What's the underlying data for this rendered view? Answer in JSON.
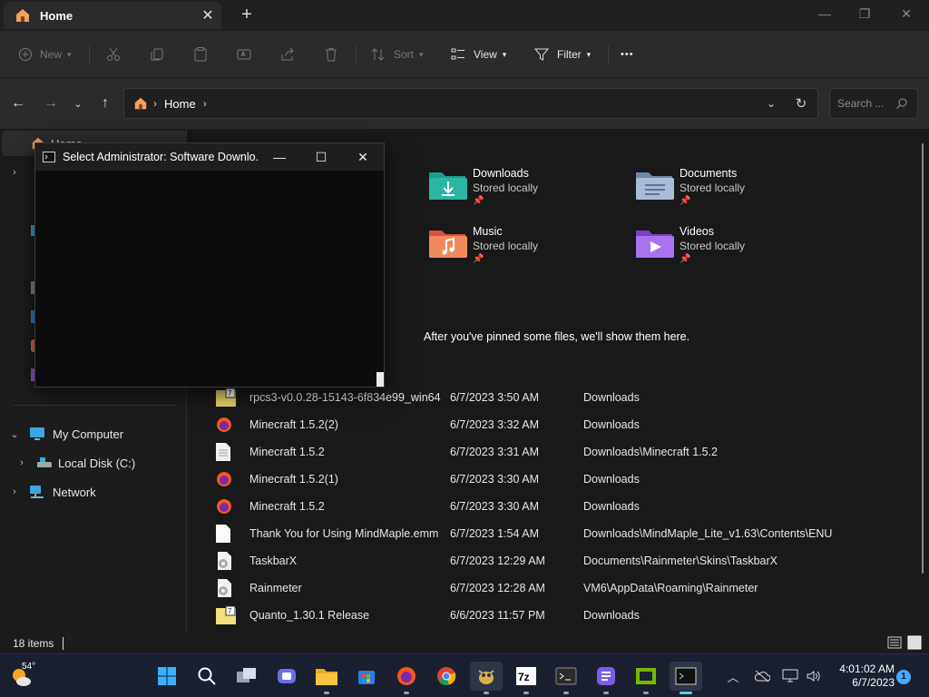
{
  "window": {
    "tab_title": "Home",
    "tab_close": "✕",
    "new_tab": "+",
    "minimize": "—",
    "maximize": "❐",
    "close": "✕"
  },
  "toolbar": {
    "new_label": "New",
    "sort_label": "Sort",
    "view_label": "View",
    "filter_label": "Filter",
    "more_label": "•••"
  },
  "address": {
    "crumbs": [
      "Home"
    ],
    "search_placeholder": "Search ..."
  },
  "nav": {
    "items": [
      {
        "label": "Home",
        "icon": "home-icon"
      },
      {
        "label": "My Computer",
        "icon": "computer-icon"
      },
      {
        "label": "Local Disk (C:)",
        "icon": "drive-icon"
      },
      {
        "label": "Network",
        "icon": "network-icon"
      }
    ]
  },
  "quick_access": [
    {
      "name": "Downloads",
      "sub": "Stored locally",
      "icon": "downloads-folder-icon",
      "color": "#2bb5a3"
    },
    {
      "name": "Documents",
      "sub": "Stored locally",
      "icon": "documents-folder-icon",
      "color": "#8aa4c8"
    },
    {
      "name": "Music",
      "sub": "Stored locally",
      "icon": "music-folder-icon",
      "color": "#e7765a"
    },
    {
      "name": "Videos",
      "sub": "Stored locally",
      "icon": "videos-folder-icon",
      "color": "#9b5de5"
    }
  ],
  "favorites_empty": "After you've pinned some files, we'll show them here.",
  "recent": [
    {
      "name": "rpcs3-v0.0.28-15143-6f834e99_win64",
      "date": "6/7/2023 3:50 AM",
      "location": "Downloads",
      "icon": "archive-icon"
    },
    {
      "name": "Minecraft 1.5.2(2)",
      "date": "6/7/2023 3:32 AM",
      "location": "Downloads",
      "icon": "firefox-file-icon"
    },
    {
      "name": "Minecraft 1.5.2",
      "date": "6/7/2023 3:31 AM",
      "location": "Downloads\\Minecraft 1.5.2",
      "icon": "text-file-icon"
    },
    {
      "name": "Minecraft 1.5.2(1)",
      "date": "6/7/2023 3:30 AM",
      "location": "Downloads",
      "icon": "firefox-file-icon"
    },
    {
      "name": "Minecraft 1.5.2",
      "date": "6/7/2023 3:30 AM",
      "location": "Downloads",
      "icon": "firefox-file-icon"
    },
    {
      "name": "Thank You for Using MindMaple.emm",
      "date": "6/7/2023 1:54 AM",
      "location": "Downloads\\MindMaple_Lite_v1.63\\Contents\\ENU",
      "icon": "blank-file-icon"
    },
    {
      "name": "TaskbarX",
      "date": "6/7/2023 12:29 AM",
      "location": "Documents\\Rainmeter\\Skins\\TaskbarX",
      "icon": "settings-file-icon"
    },
    {
      "name": "Rainmeter",
      "date": "6/7/2023 12:28 AM",
      "location": "VM6\\AppData\\Roaming\\Rainmeter",
      "icon": "settings-file-icon"
    },
    {
      "name": "Quanto_1.30.1 Release",
      "date": "6/6/2023 11:57 PM",
      "location": "Downloads",
      "icon": "archive-icon"
    }
  ],
  "status": {
    "items_count": "18 items"
  },
  "console": {
    "title": "Select Administrator:  Software Downlo..."
  },
  "taskbar": {
    "weather_temp": "54°",
    "time": "4:01:02 AM",
    "date": "6/7/2023",
    "notifications": "1",
    "apps": [
      "start-icon",
      "search-icon",
      "task-view-icon",
      "chat-icon",
      "file-explorer-icon",
      "store-icon",
      "firefox-icon",
      "chrome-icon",
      "mascot-app-icon",
      "7zip-icon",
      "terminal-icon",
      "notes-app-icon",
      "gpu-app-icon",
      "console-app-icon"
    ]
  }
}
